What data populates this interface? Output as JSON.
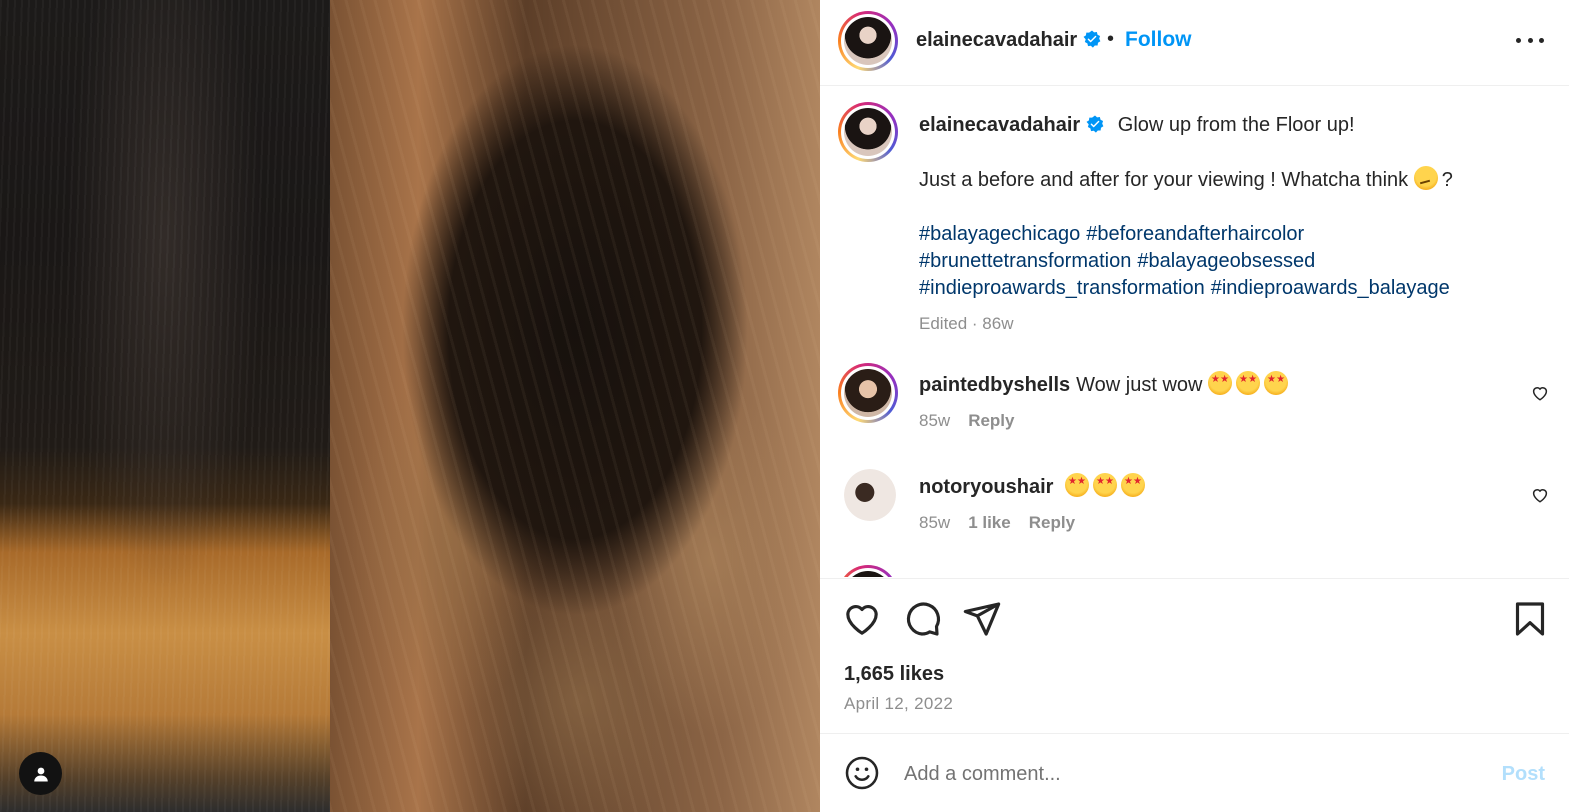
{
  "post": {
    "author": "elainecavadahair",
    "verified": true,
    "dot": "•",
    "follow_label": "Follow",
    "caption_text": "Glow up from the Floor up!",
    "caption_line2": "Just a before and after for your viewing ! Whatcha think",
    "caption_tail": "?",
    "hashtags": [
      "#balayagechicago",
      "#beforeandafterhaircolor",
      "#brunettetransformation",
      "#balayageobsessed",
      "#indieproawards_transformation",
      "#indieproawards_balayage"
    ],
    "caption_meta": "Edited · 86w",
    "likes": "1,665 likes",
    "date": "April 12, 2022"
  },
  "comments": [
    {
      "user": "paintedbyshells",
      "text": "Wow just wow",
      "age": "85w",
      "likes": "",
      "reply_label": "Reply"
    },
    {
      "user": "notoryoushair",
      "text": "",
      "age": "85w",
      "likes": "1 like",
      "reply_label": "Reply"
    }
  ],
  "comment_box": {
    "placeholder": "Add a comment...",
    "post_label": "Post"
  },
  "colors": {
    "link": "#0095f6",
    "hashtag": "#00376b",
    "muted": "#8e8e8e",
    "post_disabled": "#b2dffc"
  },
  "icons": [
    "tag-user-icon",
    "verified-badge-icon",
    "more-options-icon",
    "heart-icon",
    "comment-icon",
    "share-icon",
    "bookmark-icon",
    "emoji-icon"
  ]
}
